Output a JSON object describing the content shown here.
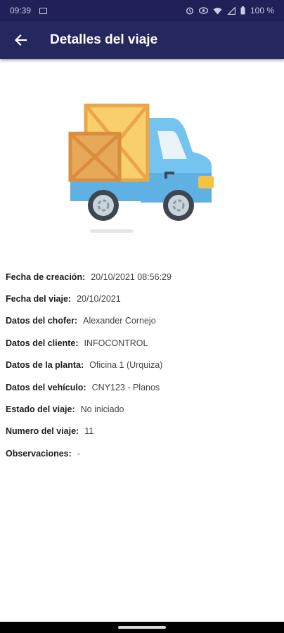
{
  "status_bar": {
    "time": "09:39",
    "battery": "100 %",
    "icons": [
      "screenshot-icon",
      "alarm-icon",
      "eye-icon",
      "wifi-icon",
      "signal-icon",
      "battery-icon"
    ]
  },
  "app_bar": {
    "title": "Detalles del viaje",
    "back_icon": "arrow-left-icon"
  },
  "colors": {
    "app_bar": "#25285f",
    "status_bar": "#1f2157"
  },
  "details": [
    {
      "label": "Fecha de creación:",
      "value": "20/10/2021 08:56:29"
    },
    {
      "label": "Fecha del viaje:",
      "value": "20/10/2021"
    },
    {
      "label": "Datos del chofer:",
      "value": "Alexander Cornejo"
    },
    {
      "label": "Datos del cliente:",
      "value": "INFOCONTROL"
    },
    {
      "label": "Datos de la planta:",
      "value": "Oficina 1 (Urquiza)"
    },
    {
      "label": "Datos del vehículo:",
      "value": "CNY123 - Planos"
    },
    {
      "label": "Estado del viaje:",
      "value": "No iniciado"
    },
    {
      "label": "Numero del viaje:",
      "value": "11"
    },
    {
      "label": "Observaciones:",
      "value": "-"
    }
  ]
}
